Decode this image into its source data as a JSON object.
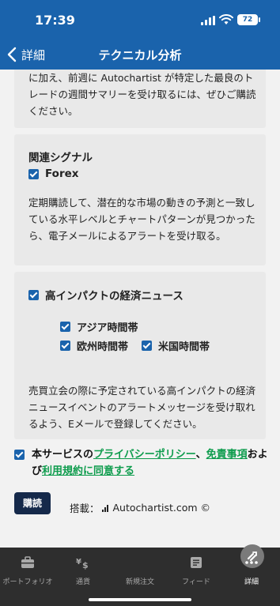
{
  "status": {
    "time": "17:39",
    "battery": "72"
  },
  "nav": {
    "back_label": "詳細",
    "title": "テクニカル分析"
  },
  "card_intro": {
    "text": "に加え、前週に Autochartist が特定した最良のトレードの週間サマリーを受け取るには、ぜひご購読ください。"
  },
  "related_signals": {
    "title": "関連シグナル",
    "option_label": "Forex",
    "option_checked": true,
    "description": "定期購読して、潜在的な市場の動きの予測と一致している水平レベルとチャートパターンが見つかったら、電子メールによるアラートを受け取る。"
  },
  "news": {
    "title": "高インパクトの経済ニュース",
    "checked": true,
    "sessions": [
      {
        "label": "アジア時間帯",
        "checked": true
      },
      {
        "label": "欧州時間帯",
        "checked": true
      },
      {
        "label": "米国時間帯",
        "checked": true
      }
    ],
    "description": "売買立会の際に予定されている高インパクトの経済ニュースイベントのアラートメッセージを受け取れるよう、Eメールで登録してください。"
  },
  "agreement": {
    "checked": true,
    "prefix": "本サービスの",
    "privacy_link": "プライバシーポリシー",
    "sep": "、",
    "disclaimer_link": "免責事項",
    "mid": "および",
    "terms_link": "利用規約に同意する"
  },
  "subscribe_label": "購読",
  "credit": {
    "prefix": "搭載：",
    "brand": "Autochartist.com ©"
  },
  "tabs": [
    {
      "label": "ポートフォリオ",
      "icon": "briefcase-icon"
    },
    {
      "label": "通貨",
      "icon": "currency-icon"
    },
    {
      "label": "新規注文",
      "icon": "new-order-icon"
    },
    {
      "label": "フィード",
      "icon": "feed-icon"
    },
    {
      "label": "詳細",
      "icon": "more-icon",
      "active": true
    }
  ]
}
